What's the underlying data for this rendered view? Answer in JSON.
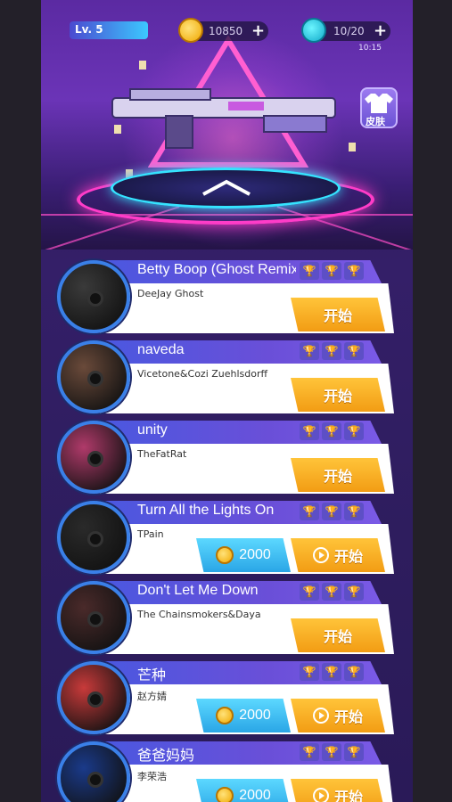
{
  "header": {
    "level": "Lv. 5",
    "coins": "10850",
    "energy": "10/20",
    "energy_timer": "10:15",
    "skin_label": "皮肤"
  },
  "colors": {
    "start_button": "#f29c14",
    "buy_button": "#2aa6e6",
    "title_bar": "#4a58e0"
  },
  "icons": {
    "coin": "coin-icon",
    "energy": "lightning-icon",
    "trophy": "trophy-icon",
    "play": "play-icon"
  },
  "songs": [
    {
      "title": "Betty Boop (Ghost Remix)",
      "artist": "DeeJay Ghost",
      "action": "开始",
      "price": null,
      "trophies_earned": 1,
      "cover": "#3a3a3a"
    },
    {
      "title": "naveda",
      "artist": "Vicetone&Cozi Zuehlsdorff",
      "action": "开始",
      "price": null,
      "trophies_earned": 1,
      "cover": "#6a4a3a"
    },
    {
      "title": "unity",
      "artist": "TheFatRat",
      "action": "开始",
      "price": null,
      "trophies_earned": 0,
      "cover": "#b03a6a"
    },
    {
      "title": "Turn All the Lights On",
      "artist": "TPain",
      "action": "开始",
      "price": "2000",
      "trophies_earned": 0,
      "cover": "#2a2a2a"
    },
    {
      "title": "Don't Let Me Down",
      "artist": "The Chainsmokers&Daya",
      "action": "开始",
      "price": null,
      "trophies_earned": 0,
      "cover": "#4a2a2a"
    },
    {
      "title": "芒种",
      "artist": "赵方婧",
      "action": "开始",
      "price": "2000",
      "trophies_earned": 0,
      "cover": "#c83a3a"
    },
    {
      "title": "爸爸妈妈",
      "artist": "李荣浩",
      "action": "开始",
      "price": "2000",
      "trophies_earned": 0,
      "cover": "#1a3a8a"
    }
  ]
}
